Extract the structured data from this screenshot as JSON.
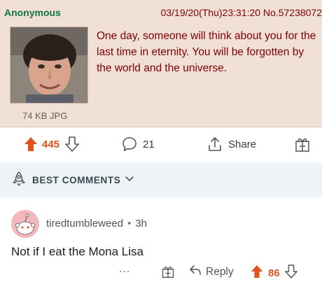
{
  "post": {
    "name": "Anonymous",
    "meta": "03/19/20(Thu)23:31:20 No.57238072",
    "file_info": "74 KB JPG",
    "text": "One day, someone will think about you for the last time in eternity. You will be forgotten by the world and the universe."
  },
  "actions": {
    "upvotes": "445",
    "comments": "21",
    "share_label": "Share"
  },
  "best_comments": {
    "label": "BEST COMMENTS"
  },
  "comment": {
    "username": "tiredtumbleweed",
    "separator": "•",
    "age": "3h",
    "body": "Not if I eat the Mona Lisa",
    "more": "...",
    "reply_label": "Reply",
    "votes": "86"
  },
  "colors": {
    "post_background": "#f0e0d6",
    "name_green": "#117743",
    "post_text_maroon": "#800000",
    "upvote_orange": "#e0531f",
    "best_bar_background": "#eef3f6"
  },
  "icons": [
    "upvote-arrow-icon",
    "downvote-arrow-icon",
    "comment-bubble-icon",
    "share-icon",
    "award-gift-icon",
    "rocket-icon",
    "chevron-down-icon",
    "reply-icon",
    "snoo-avatar-icon"
  ]
}
